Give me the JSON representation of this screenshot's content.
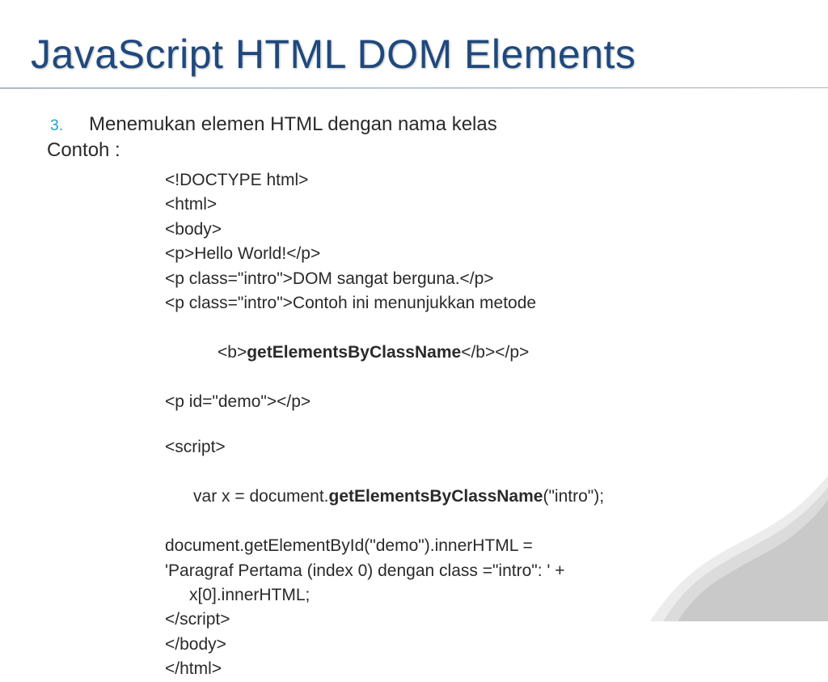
{
  "title": "JavaScript HTML DOM Elements",
  "list_number": "3.",
  "list_heading": "Menemukan elemen HTML dengan nama kelas",
  "sublead": "Contoh :",
  "code": {
    "l1": "<!DOCTYPE html>",
    "l2": "<html>",
    "l3": "<body>",
    "l4": "<p>Hello World!</p>",
    "l5": "<p class=\"intro\">DOM sangat berguna.</p>",
    "l6": "<p class=\"intro\">Contoh ini menunjukkan metode",
    "l6b_open": "<b>",
    "l6b_mid": "getElementsByClassName",
    "l6b_close": "</b></p>",
    "l7": "<p id=\"demo\"></p>",
    "l8": "<script>",
    "l9_pre": "var x = document.",
    "l9_bold": "getElementsByClassName",
    "l9_post": "(\"intro\");",
    "l10": "document.getElementById(\"demo\").innerHTML =",
    "l11a": "'Paragraf Pertama (index 0) dengan class =\"intro\": ' +",
    "l11b": "x[0].innerHTML;",
    "l12": "</script>",
    "l13": "</body>",
    "l14": "</html>"
  }
}
